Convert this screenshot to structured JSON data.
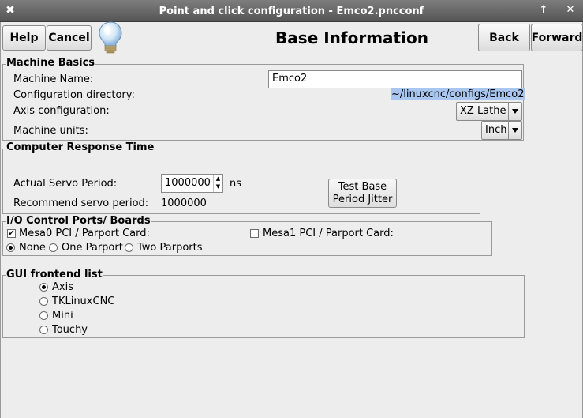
{
  "window": {
    "title": "Point and click configuration - Emco2.pncconf",
    "controls": {
      "maximize_glyph": "↑",
      "close_glyph": "✕",
      "menu_glyph": "✖"
    }
  },
  "toolbar": {
    "help_label": "Help",
    "cancel_label": "Cancel",
    "page_title": "Base Information",
    "back_label": "Back",
    "forward_label": "Forward"
  },
  "machine_basics": {
    "title": "Machine Basics",
    "name_label": "Machine Name:",
    "name_value": "Emco2",
    "config_dir_label": "Configuration directory:",
    "config_dir_value": "~/linuxcnc/configs/Emco2",
    "axis_label": "Axis configuration:",
    "axis_value": "XZ Lathe",
    "units_label": "Machine units:",
    "units_value": "Inch"
  },
  "response_time": {
    "title": "Computer Response Time",
    "servo_label": "Actual Servo Period:",
    "servo_value": "1000000",
    "servo_unit": "ns",
    "recommend_label": "Recommend servo period:",
    "recommend_value": "1000000",
    "test_button_line1": "Test Base",
    "test_button_line2": "Period Jitter"
  },
  "io_ports": {
    "title": "I/O Control Ports/ Boards",
    "mesa0_label": "Mesa0 PCI / Parport Card:",
    "mesa0_checked": true,
    "mesa1_label": "Mesa1 PCI / Parport Card:",
    "mesa1_checked": false,
    "parport_options": [
      "None",
      "One Parport",
      "Two Parports"
    ],
    "parport_selected": "None"
  },
  "gui_frontend": {
    "title": "GUI frontend list",
    "options": [
      "Axis",
      "TKLinuxCNC",
      "Mini",
      "Touchy"
    ],
    "selected": "Axis"
  },
  "icons": [
    "lightbulb-icon",
    "window-menu-icon",
    "maximize-icon",
    "close-icon"
  ],
  "colors": {
    "titlebar": "#606060",
    "selection": "#a8c6ee",
    "window_bg": "#ededed"
  }
}
